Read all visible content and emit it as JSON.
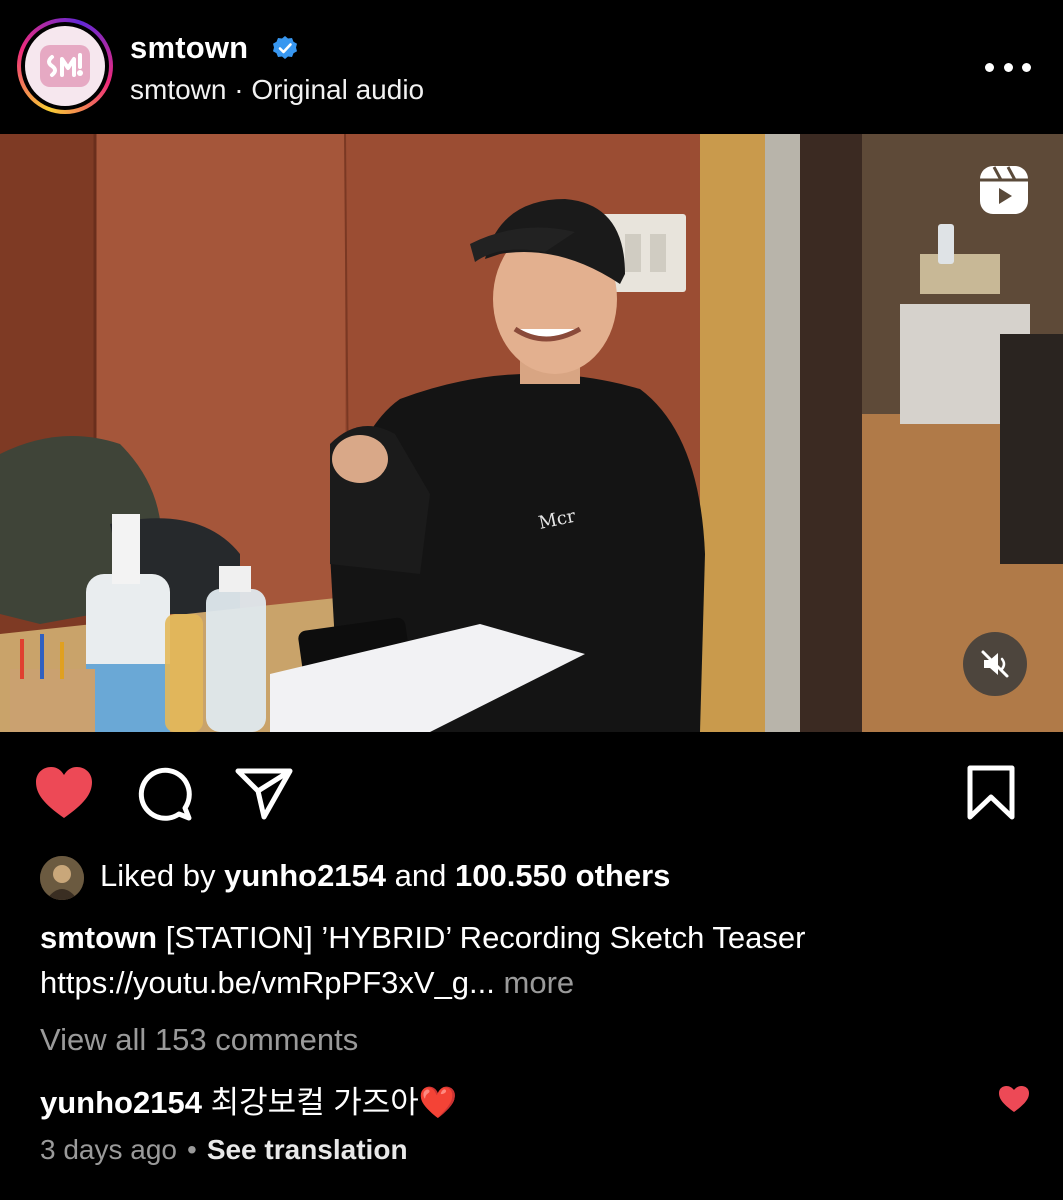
{
  "header": {
    "username": "smtown",
    "audio_line": "smtown · Original audio"
  },
  "actions": {
    "liked": true
  },
  "likes": {
    "prefix": "Liked by ",
    "user": "yunho2154",
    "middle": " and ",
    "count_text": "100.550 others"
  },
  "caption": {
    "username": "smtown",
    "text": " [STATION] ’HYBRID’ Recording Sketch Teaser",
    "link": "https://youtu.be/vmRpPF3xV_g...",
    "more_label": " more"
  },
  "comments": {
    "view_all": "View all 153 comments",
    "top_comment": {
      "username": "yunho2154",
      "text": " 최강보컬 가즈아❤️"
    }
  },
  "meta": {
    "time_ago": "3 days ago",
    "separator": "•",
    "see_translation": "See translation"
  },
  "colors": {
    "like_red": "#ed4956",
    "verified_blue": "#3897f0",
    "muted_gray": "#9a9a9a"
  },
  "icons": {
    "verified": "verified-badge-icon",
    "more": "more-dots-icon",
    "reels": "reels-icon",
    "mute": "mute-icon",
    "like": "heart-icon",
    "comment": "comment-icon",
    "share": "share-icon",
    "save": "bookmark-icon"
  }
}
